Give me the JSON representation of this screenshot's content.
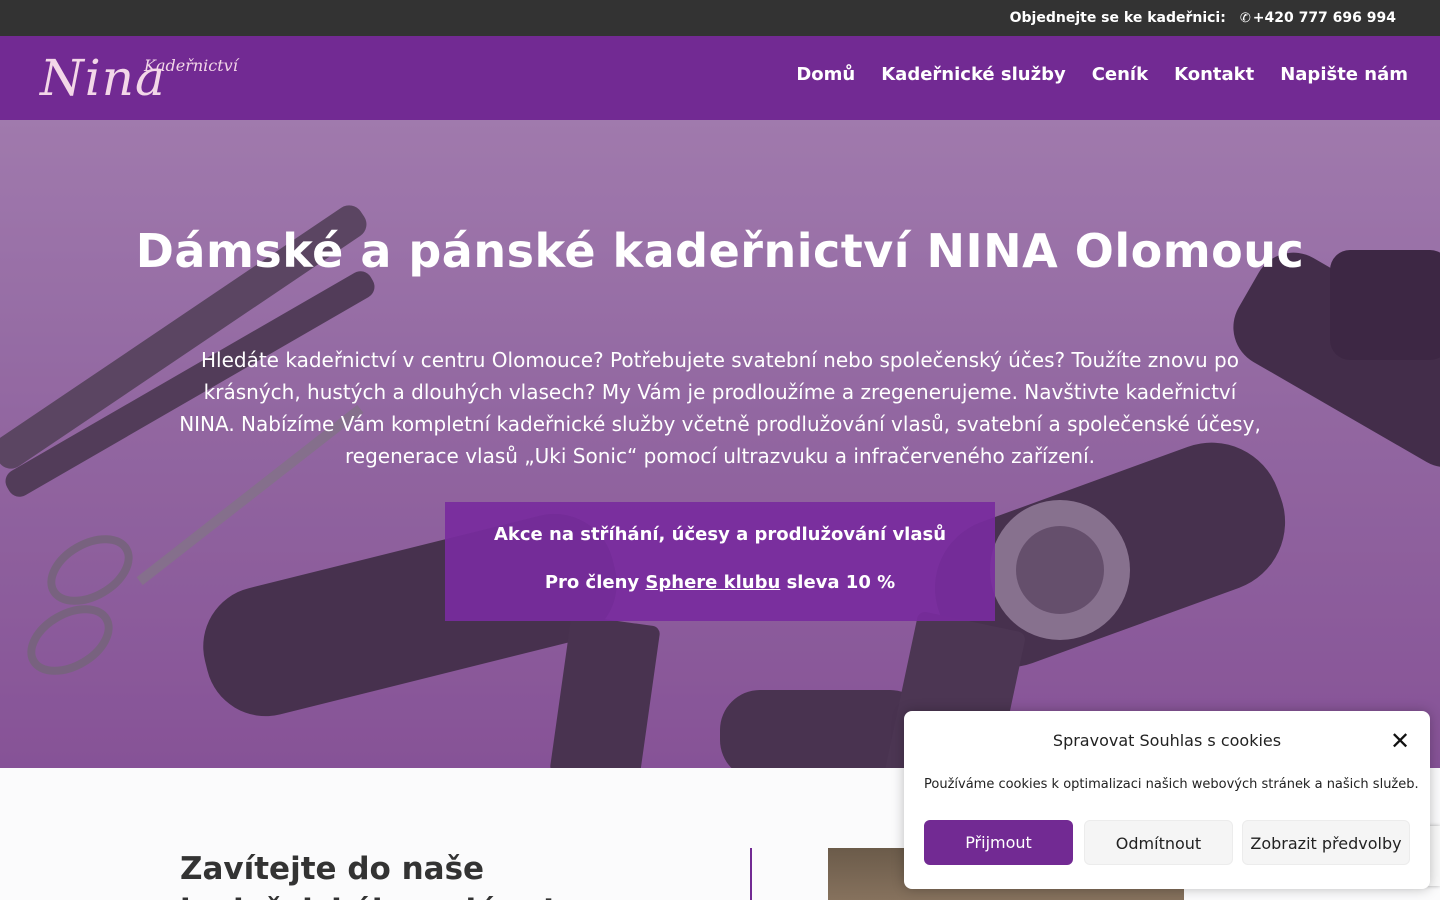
{
  "topbar": {
    "label": "Objednejte se ke kadeřnici:",
    "phone": "+420 777 696 994",
    "phone_icon": "phone-icon"
  },
  "header": {
    "logo": {
      "main": "Nina",
      "small": "Kadeřnictví"
    },
    "nav": [
      {
        "label": "Domů"
      },
      {
        "label": "Kadeřnické služby"
      },
      {
        "label": "Ceník"
      },
      {
        "label": "Kontakt"
      },
      {
        "label": "Napište nám"
      }
    ]
  },
  "hero": {
    "title": "Dámské a pánské kadeřnictví NINA Olomouc",
    "text": "Hledáte kadeřnictví v centru Olomouce? Potřebujete svatební nebo společenský účes? Toužíte znovu po krásných, hustých a dlouhých vlasech? My Vám je prodloužíme a zregenerujeme. Navštivte kadeřnictví NINA. Nabízíme Vám kompletní kadeřnické služby včetně prodlužování vlasů, svatební a společenské účesy, regenerace vlasů „Uki Sonic“ pomocí ultrazvuku a infračerveného zařízení.",
    "promo": {
      "line1": "Akce na stříhání, účesy a prodlužování vlasů",
      "line2_prefix": "Pro členy ",
      "line2_link": "Sphere klubu",
      "line2_suffix": " sleva 10 %"
    }
  },
  "about": {
    "title": "Zavítejte do naše kadeřnického salónu!"
  },
  "cookie": {
    "title": "Spravovat Souhlas s cookies",
    "text": "Používáme cookies k optimalizaci našich webových stránek a našich služeb.",
    "accept": "Přijmout",
    "deny": "Odmítnout",
    "prefs": "Zobrazit předvolby",
    "close_icon": "close-icon"
  },
  "colors": {
    "brand_purple": "#722a93",
    "topbar": "#333333",
    "promo_bg": "#782b9e"
  }
}
